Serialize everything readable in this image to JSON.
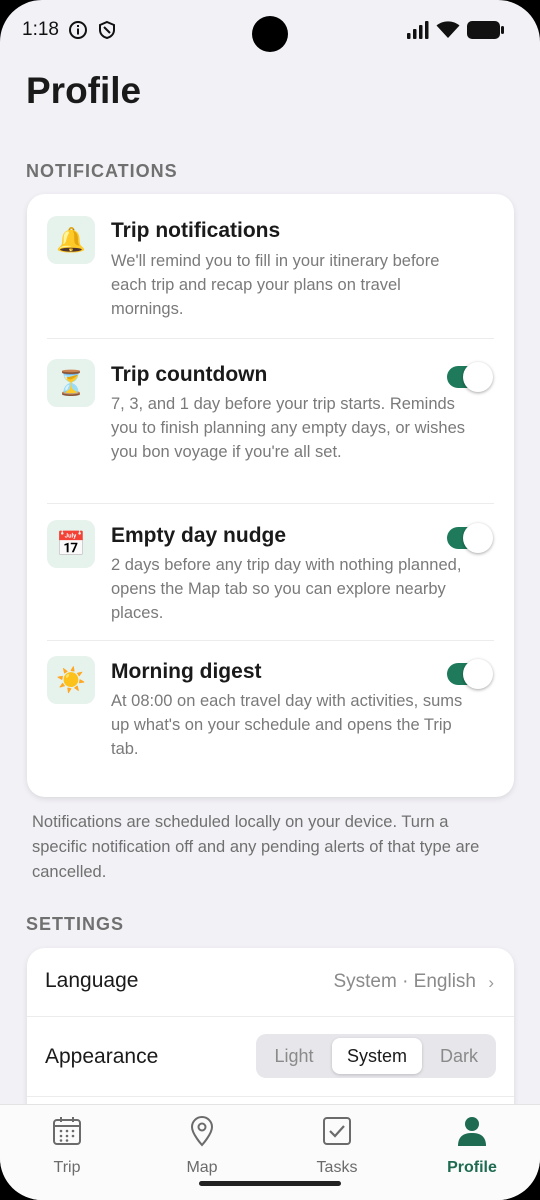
{
  "status_bar": {
    "time": "1:18",
    "icons": [
      "info-icon",
      "shield-icon",
      "signal-icon",
      "wifi-icon",
      "battery-icon"
    ]
  },
  "page": {
    "title": "Profile"
  },
  "notifications": {
    "section_label": "NOTIFICATIONS",
    "items": [
      {
        "icon": "🔔",
        "icon_name": "bell-icon",
        "title": "Trip notifications",
        "description": "We'll remind you to fill in your itinerary before each trip and recap your plans on travel mornings.",
        "has_toggle": false
      },
      {
        "icon": "⏳",
        "icon_name": "hourglass-icon",
        "title": "Trip countdown",
        "description": "7, 3, and 1 day before your trip starts. Reminds you to finish planning any empty days, or wishes you bon voyage if you're all set.",
        "has_toggle": true,
        "enabled": true
      },
      {
        "icon": "📅",
        "icon_name": "calendar-icon",
        "title": "Empty day nudge",
        "description": "2 days before any trip day with nothing planned, opens the Map tab so you can explore nearby places.",
        "has_toggle": true,
        "enabled": true
      },
      {
        "icon": "☀️",
        "icon_name": "sun-icon",
        "title": "Morning digest",
        "description": "At 08:00 on each travel day with activities, sums up what's on your schedule and opens the Trip tab.",
        "has_toggle": true,
        "enabled": true
      }
    ],
    "footnote": "Notifications are scheduled locally on your device. Turn a specific notification off and any pending alerts of that type are cancelled."
  },
  "settings": {
    "section_label": "SETTINGS",
    "language": {
      "label": "Language",
      "value": "System · English",
      "chevron": "›"
    },
    "appearance": {
      "label": "Appearance",
      "options": [
        "Light",
        "System",
        "Dark"
      ],
      "selected": "System"
    }
  },
  "bottom_nav": {
    "items": [
      {
        "label": "Trip",
        "icon": "calendar-grid-icon",
        "active": false
      },
      {
        "label": "Map",
        "icon": "map-pin-icon",
        "active": false
      },
      {
        "label": "Tasks",
        "icon": "checkbox-icon",
        "active": false
      },
      {
        "label": "Profile",
        "icon": "person-icon",
        "active": true
      }
    ]
  },
  "colors": {
    "accent": "#1e7a5a",
    "background": "#f2f1f6",
    "card": "#ffffff",
    "icon_tint_bg": "#e6f2ec"
  }
}
